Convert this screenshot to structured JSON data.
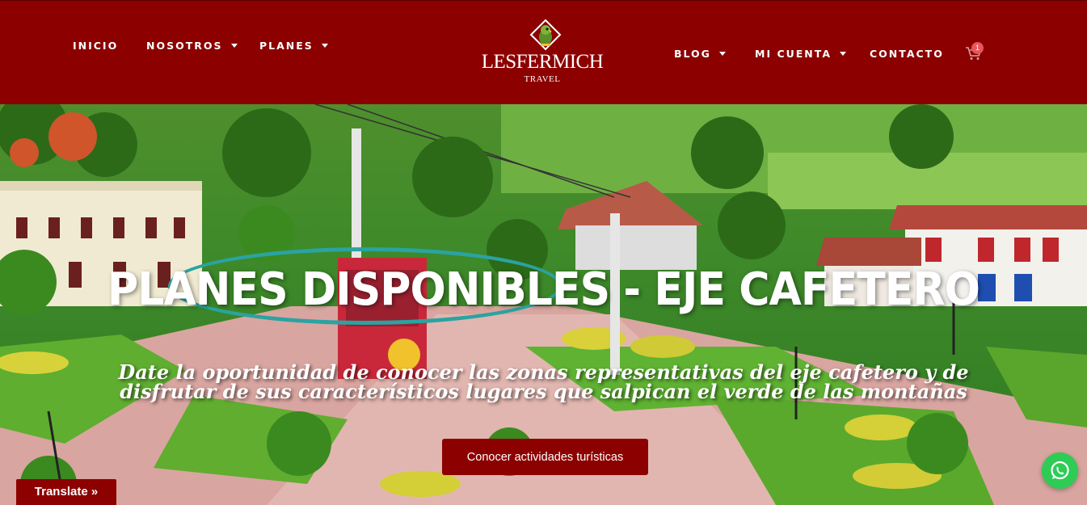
{
  "nav_left": [
    {
      "label": "INICIO",
      "dropdown": false
    },
    {
      "label": "NOSOTROS",
      "dropdown": true
    },
    {
      "label": "PLANES",
      "dropdown": true
    }
  ],
  "nav_right": [
    {
      "label": "BLOG",
      "dropdown": true
    },
    {
      "label": "MI CUENTA",
      "dropdown": true
    },
    {
      "label": "CONTACTO",
      "dropdown": false
    }
  ],
  "logo": {
    "title": "LESFERMICH",
    "subtitle": "TRAVEL"
  },
  "cart": {
    "icon": "cart-icon",
    "count": "1"
  },
  "hero": {
    "title": "PLANES DISPONIBLES - EJE CAFETERO",
    "subtitle": "Date la oportunidad de conocer las zonas representativas del eje cafetero y de disfrutar de sus característicos lugares que salpican el verde de las montañas",
    "cta_label": "Conocer actividades turísticas"
  },
  "translate": {
    "label": "Translate »"
  },
  "whatsapp": {
    "icon": "whatsapp-icon"
  },
  "colors": {
    "brand": "#8c0000",
    "accent": "#2aa3a1",
    "badge": "#e8565d",
    "whatsapp": "#2ecc55"
  }
}
